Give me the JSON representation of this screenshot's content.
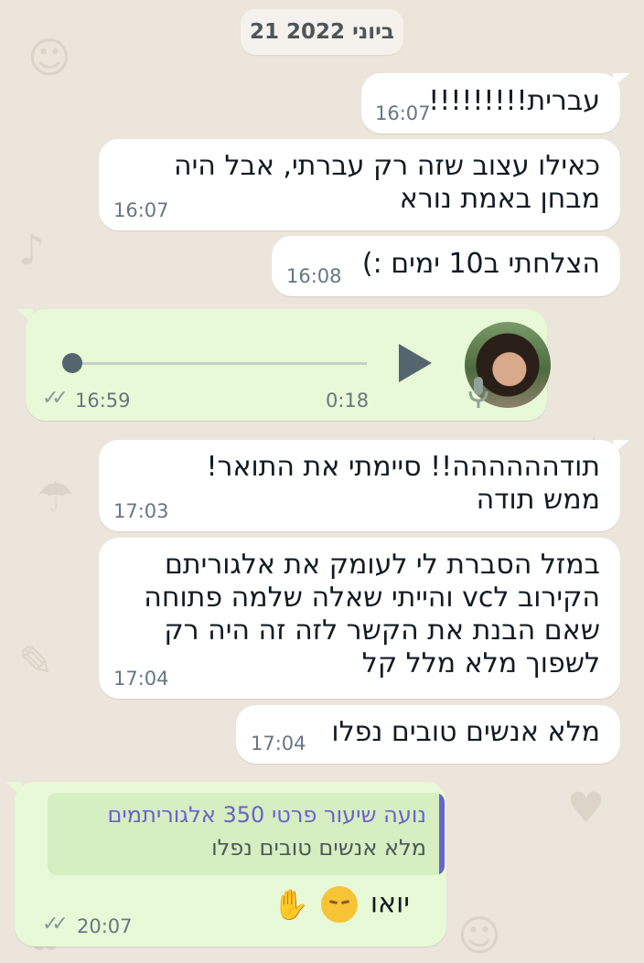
{
  "date_label": "21 ביוני 2022",
  "messages": [
    {
      "text": "עברית!!!!!!!!!",
      "time": "16:07"
    },
    {
      "text": "כאילו עצוב שזה רק עברתי, אבל היה\nמבחן באמת נורא",
      "time": "16:07"
    },
    {
      "text": "הצלחתי ב10 ימים :)",
      "time": "16:08"
    },
    {
      "text": "תודהההההה!! סיימתי את התואר!\nממש תודה",
      "time": "17:03"
    },
    {
      "text": "במזל הסברת לי לעומק את אלגוריתם\nהקירוב לvc והייתי שאלה שלמה פתוחה\nשאם הבנת את הקשר לזה זה היה רק\nלשפוך מלא מלל קל",
      "time": "17:04"
    },
    {
      "text": "מלא אנשים טובים נפלו",
      "time": "17:04"
    }
  ],
  "voice_message": {
    "time": "16:59",
    "duration": "0:18",
    "progress": 0
  },
  "reply_message": {
    "quote_author": "נועה שיעור פרטי 350 אלגוריתמים",
    "quote_text": "מלא אנשים טובים נפלו",
    "text": "יואו",
    "emojis": [
      "pensive-face",
      "folded-hands"
    ],
    "time": "20:07"
  },
  "colors": {
    "background": "#ece5dc",
    "incoming_bubble": "#ffffff",
    "outgoing_bubble": "#e7f9d6",
    "quote_accent": "#6b63c8"
  }
}
